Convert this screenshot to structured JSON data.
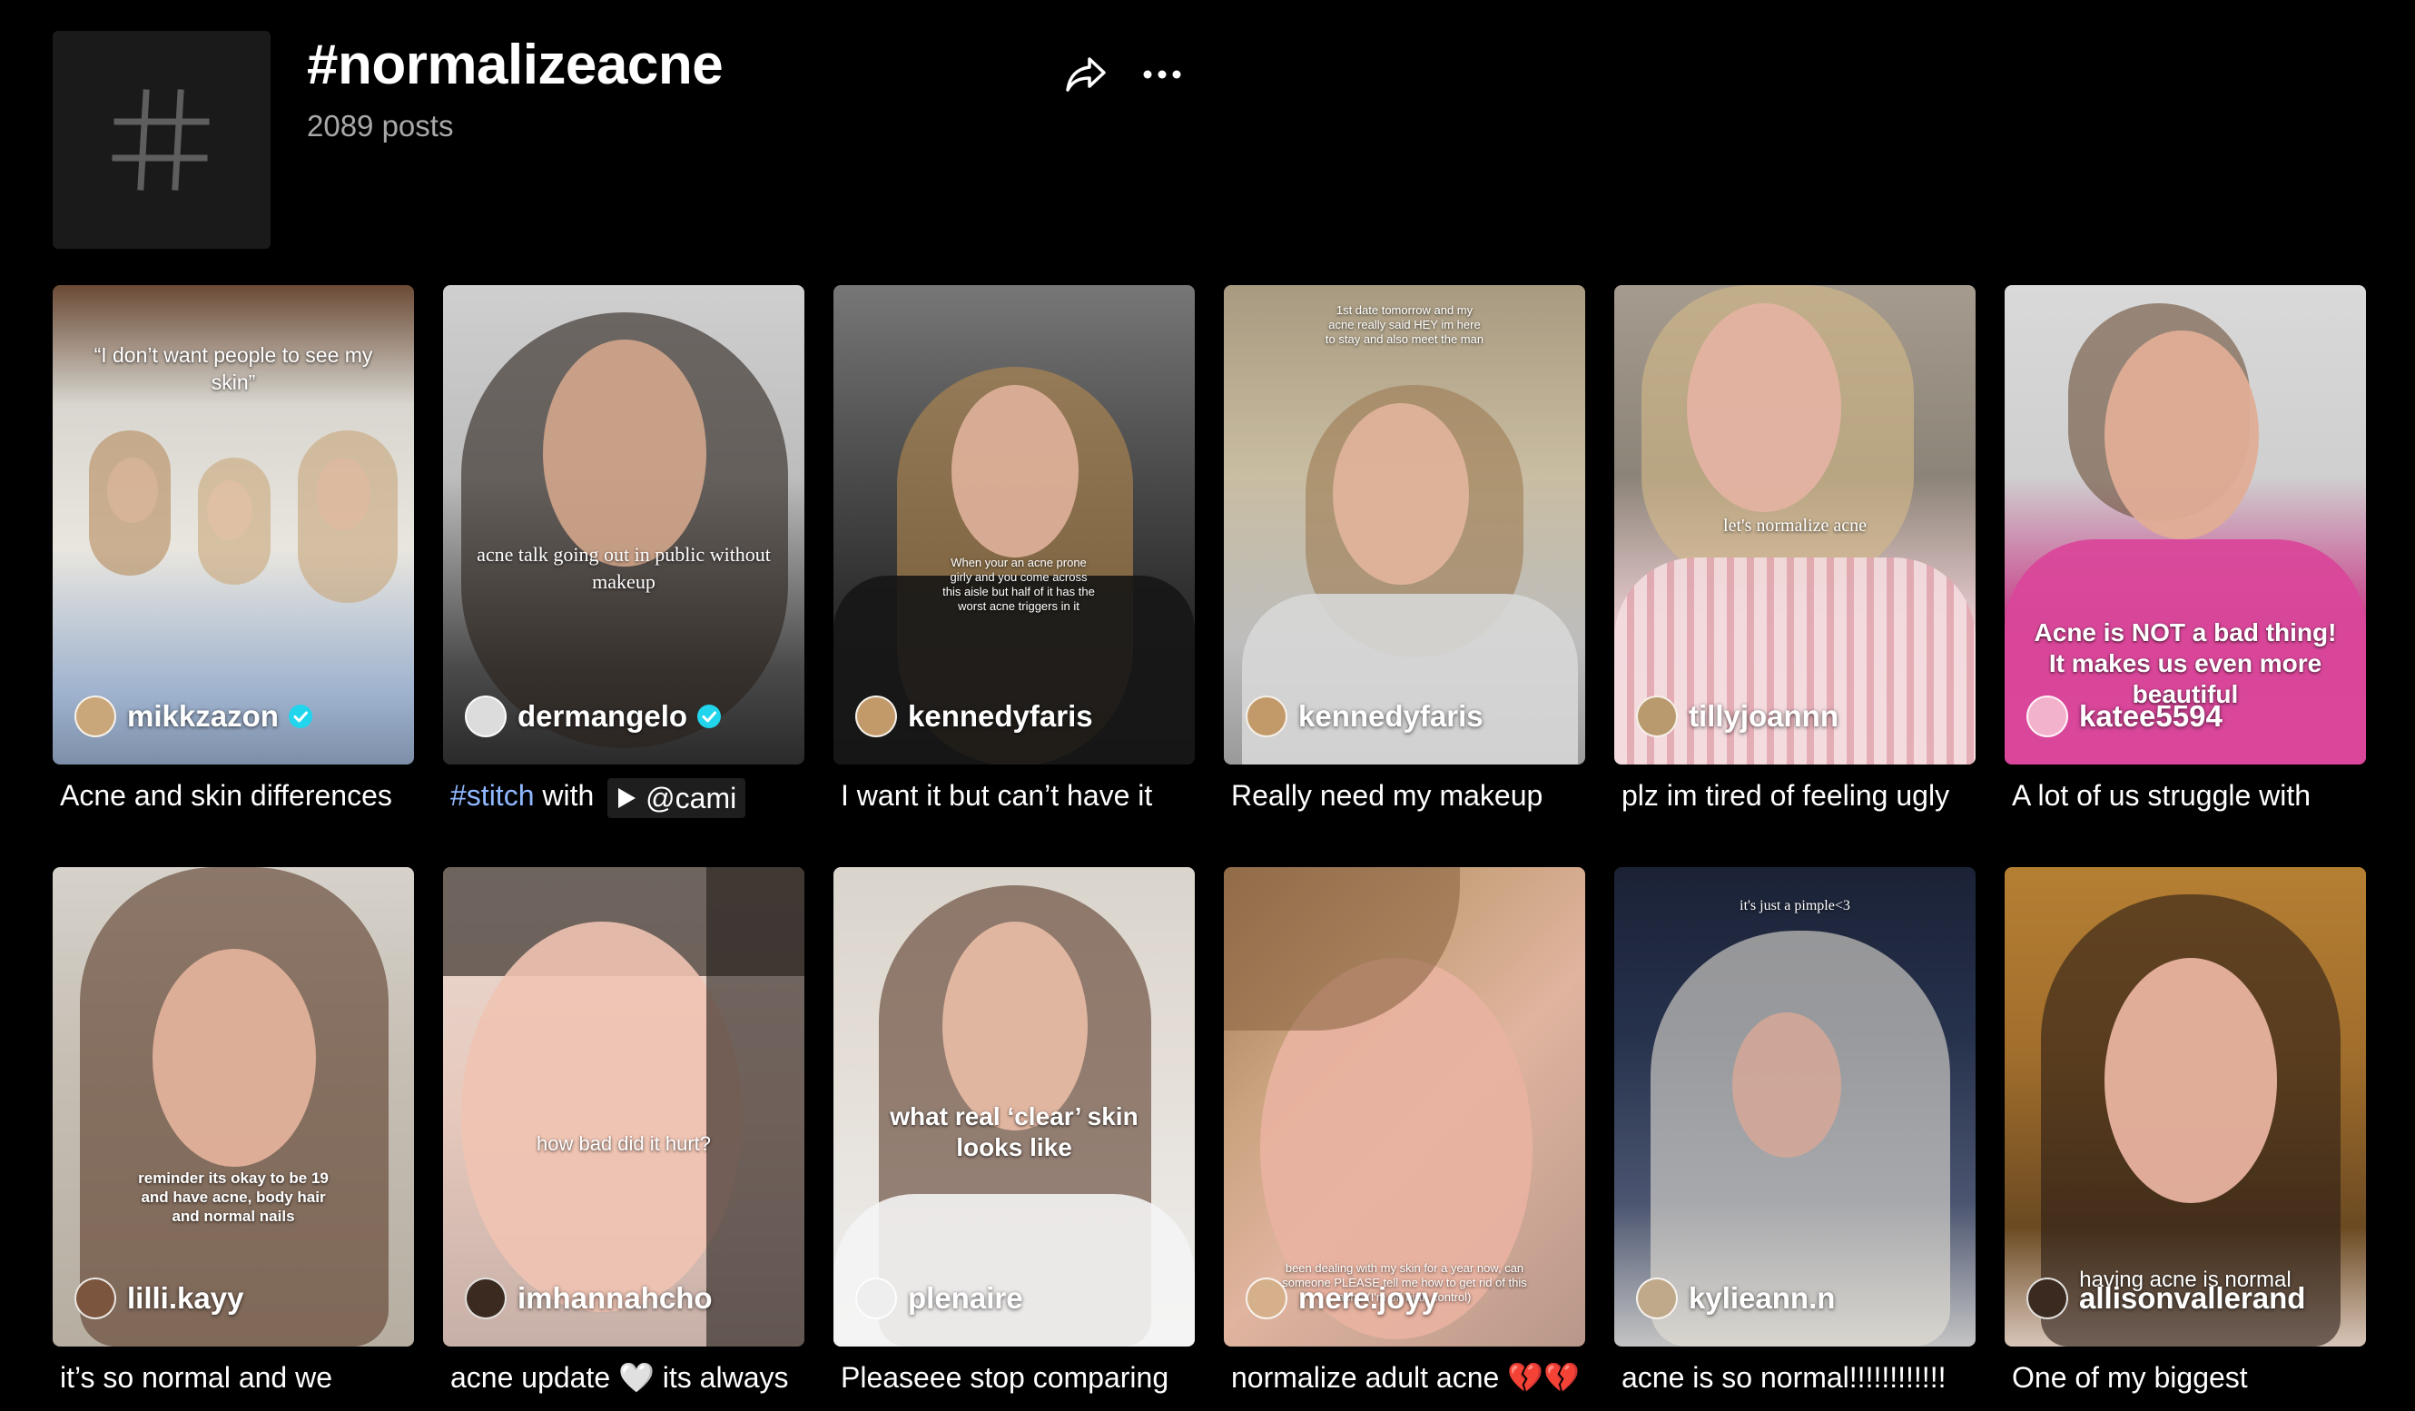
{
  "header": {
    "title": "#normalizeacne",
    "post_count": "2089 posts"
  },
  "icons": {
    "hashtag": "hashtag-icon",
    "share": "share-arrow-icon",
    "more": "more-dots-icon",
    "verified": "verified-badge-icon",
    "play": "play-icon"
  },
  "colors": {
    "background": "#000000",
    "secondary_text": "#a8a8a8",
    "hashtag_link": "#8fb8ff",
    "verified": "#20d5ec"
  },
  "videos": [
    {
      "overlay": "“I don’t want people to see my skin”",
      "author": "mikkzazon",
      "verified": true,
      "caption": "Acne and skin differences"
    },
    {
      "overlay": "acne talk going out in public without makeup",
      "author": "dermangelo",
      "verified": true,
      "caption_parts": {
        "tag": "#stitch",
        "with": "with",
        "mention": "@cami"
      }
    },
    {
      "overlay": "When your an acne prone girly and you come across this aisle but half of it has the worst acne triggers in it",
      "author": "kennedyfaris",
      "verified": false,
      "caption": "I want it but can’t have it"
    },
    {
      "overlay": "1st date tomorrow and my acne really said HEY im here to stay and also meet the man",
      "author": "kennedyfaris",
      "verified": false,
      "caption": "Really need my makeup"
    },
    {
      "overlay": "let's normalize acne",
      "author": "tillyjoannn",
      "verified": false,
      "caption": "plz im tired of feeling ugly"
    },
    {
      "overlay": "Acne is NOT a bad thing! It makes us even more beautiful",
      "author": "katee5594",
      "verified": false,
      "caption": "A lot of us struggle with"
    },
    {
      "overlay": "reminder its okay to be 19 and have acne, body hair and normal nails",
      "author": "lilli.kayy",
      "verified": false,
      "caption": "it’s so normal and we"
    },
    {
      "overlay": "how bad did it hurt?",
      "author": "imhannahcho",
      "verified": false,
      "caption": "acne update 🤍 its always"
    },
    {
      "overlay": "what real ‘clear’ skin looks like",
      "author": "plenaire",
      "verified": false,
      "caption": "Pleaseee stop comparing"
    },
    {
      "overlay": "been dealing with my skin for a year now, can someone PLEASE tell me how to get rid of this acne (I'm off birth control)",
      "author": "mere.joyy",
      "verified": false,
      "caption": "normalize adult acne 💔💔"
    },
    {
      "overlay": "it's just a pimple<3",
      "author": "kylieann.n",
      "verified": false,
      "caption": "acne is so normal!!!!!!!!!!!!"
    },
    {
      "overlay": "having acne is normal",
      "author": "allisonvallerand",
      "verified": false,
      "caption": "One of my biggest"
    }
  ]
}
